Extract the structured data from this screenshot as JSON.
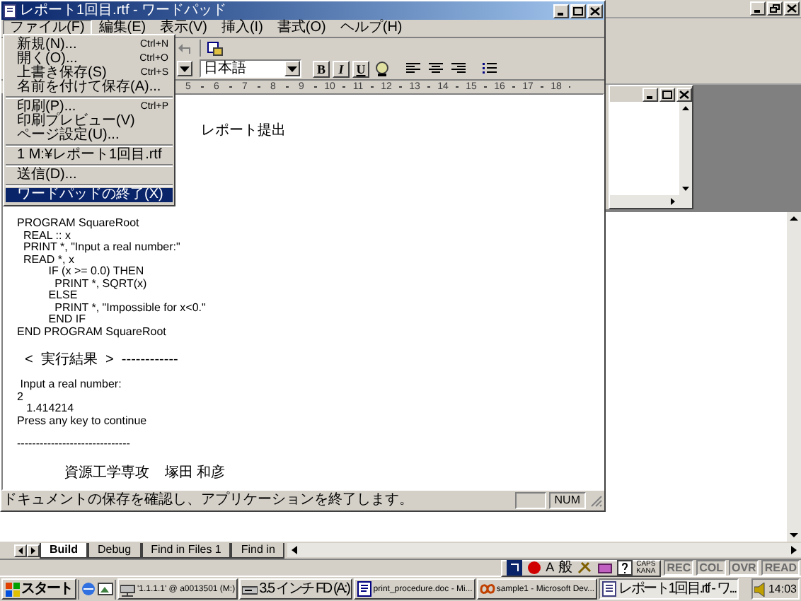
{
  "background_app": {
    "output_tabs": [
      {
        "label": "Build",
        "selected": true
      },
      {
        "label": "Debug",
        "selected": false
      },
      {
        "label": "Find in Files 1",
        "selected": false
      },
      {
        "label": "Find in",
        "selected": false
      }
    ],
    "language_bar": {
      "input_mode": "A",
      "dictionary": "般",
      "caps": "CAPS",
      "kana": "KANA"
    },
    "status_indicators": [
      {
        "label": "REC",
        "disabled": true
      },
      {
        "label": "COL",
        "disabled": true
      },
      {
        "label": "OVR",
        "disabled": true
      },
      {
        "label": "READ",
        "disabled": true
      }
    ]
  },
  "wordpad": {
    "title": "レポート1回目.rtf - ワードパッド",
    "menu": [
      {
        "label": "ファイル(F)",
        "selected": true
      },
      {
        "label": "編集(E)",
        "selected": false
      },
      {
        "label": "表示(V)",
        "selected": false
      },
      {
        "label": "挿入(I)",
        "selected": false
      },
      {
        "label": "書式(O)",
        "selected": false
      },
      {
        "label": "ヘルプ(H)",
        "selected": false
      }
    ],
    "format_bar": {
      "script": "日本語",
      "style_buttons": [
        {
          "label": "B",
          "kind": "bold"
        },
        {
          "label": "I",
          "kind": "italic"
        },
        {
          "label": "U",
          "kind": "underline"
        }
      ]
    },
    "ruler": {
      "labels": [
        "5",
        "6",
        "7",
        "8",
        "9",
        "10",
        "11",
        "12",
        "13",
        "14",
        "15",
        "16",
        "17",
        "18"
      ]
    },
    "document": {
      "blocks": [
        {
          "lines": [
            "レポート提出"
          ]
        },
        {
          "lines": [
            "PROGRAM SquareRoot",
            "  REAL :: x",
            "  PRINT *, \"Input a real number:\"",
            "  READ *, x",
            "          IF (x >= 0.0) THEN",
            "            PRINT *, SQRT(x)",
            "          ELSE",
            "            PRINT *, \"Impossible for x<0.\"",
            "          END IF",
            "END PROGRAM SquareRoot"
          ]
        },
        {
          "lines": [
            "  <  実行結果  >  ------------"
          ]
        },
        {
          "lines": [
            " Input a real number:",
            "2",
            "   1.414214",
            "Press any key to continue"
          ]
        },
        {
          "lines": [
            "------------------------------"
          ]
        },
        {
          "lines": [
            "            資源工学専攻    塚田 和彦"
          ]
        }
      ]
    },
    "status_bar": {
      "message": "ドキュメントの保存を確認し、アプリケーションを終了します。",
      "panels": [
        "NUM"
      ]
    }
  },
  "file_menu": {
    "items": [
      {
        "kind": "item",
        "label": "新規(N)...",
        "shortcut": "Ctrl+N",
        "selected": false
      },
      {
        "kind": "item",
        "label": "開く(O)...",
        "shortcut": "Ctrl+O",
        "selected": false
      },
      {
        "kind": "item",
        "label": "上書き保存(S)",
        "shortcut": "Ctrl+S",
        "selected": false
      },
      {
        "kind": "item",
        "label": "名前を付けて保存(A)...",
        "selected": false
      },
      {
        "kind": "separator"
      },
      {
        "kind": "item",
        "label": "印刷(P)...",
        "shortcut": "Ctrl+P",
        "selected": false
      },
      {
        "kind": "item",
        "label": "印刷プレビュー(V)",
        "selected": false
      },
      {
        "kind": "item",
        "label": "ページ設定(U)...",
        "selected": false
      },
      {
        "kind": "separator"
      },
      {
        "kind": "item",
        "label": "1 M:¥レポート1回目.rtf",
        "selected": false
      },
      {
        "kind": "separator"
      },
      {
        "kind": "item",
        "label": "送信(D)...",
        "selected": false
      },
      {
        "kind": "separator"
      },
      {
        "kind": "item",
        "label": "ワードパッドの終了(X)",
        "selected": true
      }
    ]
  },
  "taskbar": {
    "start": "スタート",
    "tasks": [
      {
        "label": "'1.1.1.1' @ a0013501 (M:)",
        "selected": false
      },
      {
        "label": "3.5 インチ FD (A:)",
        "selected": false
      },
      {
        "label": "print_procedure.doc - Mi...",
        "selected": false
      },
      {
        "label": "sample1 - Microsoft Dev...",
        "selected": false
      },
      {
        "label": "レポート1回目.rtf - ワ...",
        "selected": true
      }
    ],
    "clock": "14:03"
  }
}
